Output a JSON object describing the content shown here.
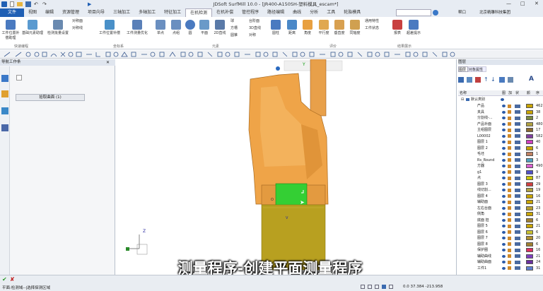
{
  "title": "JDSoft SurfMill 10.0 - [JR400-A150SH-塑料模具_escam*]",
  "tabs": [
    "文件",
    "视图",
    "编辑",
    "资源管理",
    "项目向导",
    "三轴加工",
    "多轴加工",
    "特征加工",
    "在机检测",
    "在机补偿",
    "管控程序",
    "路径编辑",
    "曲线",
    "分析",
    "工具",
    "轮胎模具"
  ],
  "active_tab": "在机检测",
  "title_right": {
    "help": "帮口",
    "company": "北京精雕科技集团"
  },
  "ribbon": {
    "buttons": [
      "工件位置补偿助理",
      "基础元素助理",
      "检测批量设置",
      "对称面",
      "对称线",
      "工件位置补偿",
      "工件测量优化",
      "单点",
      "点组",
      "圆",
      "平面",
      "2D直线",
      "球",
      "方槽",
      "圆锥",
      "台阶面",
      "3D直线",
      "对称",
      "圆柱",
      "距离",
      "角度",
      "平行度",
      "垂直度",
      "同轴度",
      "通用特性",
      "工件状态",
      "报表",
      "超差提示"
    ],
    "groups": [
      "快速编程",
      "坐标系",
      "元素",
      "评价",
      "结果展示"
    ]
  },
  "left_panel": {
    "title": "导航工作条",
    "button_label": "拾取曲面 (1)"
  },
  "viewport": {
    "label_o": "O",
    "label_v": "V",
    "axis_z": "Z",
    "axis_y": "Y"
  },
  "caption": "测量程序-创建平面测量程序",
  "right_panel": {
    "title": "图层",
    "tabs": [
      "图层",
      "对象属性"
    ],
    "headers": [
      "名称",
      "图",
      "加",
      "状",
      "颜",
      "序"
    ],
    "root": "默认类别",
    "layers": [
      {
        "name": "产品",
        "color": "#c8a400",
        "no": "462"
      },
      {
        "name": "夹具",
        "color": "#c8a400",
        "no": "38"
      },
      {
        "name": "分割线-...",
        "color": "#7a8a40",
        "no": "2"
      },
      {
        "name": "产品补面",
        "color": "#b0a040",
        "no": "480"
      },
      {
        "name": "主组图层",
        "color": "#8a6a30",
        "no": "17"
      },
      {
        "name": "L00002",
        "color": "#8040a0",
        "no": "582"
      },
      {
        "name": "图层 1",
        "color": "#d040c0",
        "no": "40"
      },
      {
        "name": "图层 2",
        "color": "#c8a400",
        "no": "6"
      },
      {
        "name": "毛坯",
        "color": "#c08060",
        "no": "1"
      },
      {
        "name": "Rs_Round",
        "color": "#50a0c0",
        "no": "3"
      },
      {
        "name": "方器",
        "color": "#d860d0",
        "no": "490"
      },
      {
        "name": "g1",
        "color": "#5050c8",
        "no": "9"
      },
      {
        "name": "点",
        "color": "#c8c400",
        "no": "87"
      },
      {
        "name": "图层 3",
        "color": "#d04040",
        "no": "29"
      },
      {
        "name": "线切割...",
        "color": "#b0a040",
        "no": "19"
      },
      {
        "name": "图层 4",
        "color": "#c8a400",
        "no": "16"
      },
      {
        "name": "辅助面",
        "color": "#c8a400",
        "no": "21"
      },
      {
        "name": "左右台面",
        "color": "#b8a030",
        "no": "23"
      },
      {
        "name": "侧角",
        "color": "#c8a400",
        "no": "31"
      },
      {
        "name": "底面 担",
        "color": "#a08030",
        "no": "6"
      },
      {
        "name": "图层 5",
        "color": "#c8a400",
        "no": "21"
      },
      {
        "name": "图层 6",
        "color": "#c8c030",
        "no": "6"
      },
      {
        "name": "图层 7",
        "color": "#b09030",
        "no": "20"
      },
      {
        "name": "图层 8",
        "color": "#a08030",
        "no": "6"
      },
      {
        "name": "保护圈",
        "color": "#e03060",
        "no": "16"
      },
      {
        "name": "辅助曲线",
        "color": "#8040c0",
        "no": "21"
      },
      {
        "name": "辅助曲面",
        "color": "#6a30a0",
        "no": "24"
      },
      {
        "name": "工件1",
        "color": "#6080d0",
        "no": "31"
      }
    ]
  },
  "status": {
    "left": "平面:检测域--|选择探测区域",
    "coords": "0.0  37.384  -213.958"
  }
}
